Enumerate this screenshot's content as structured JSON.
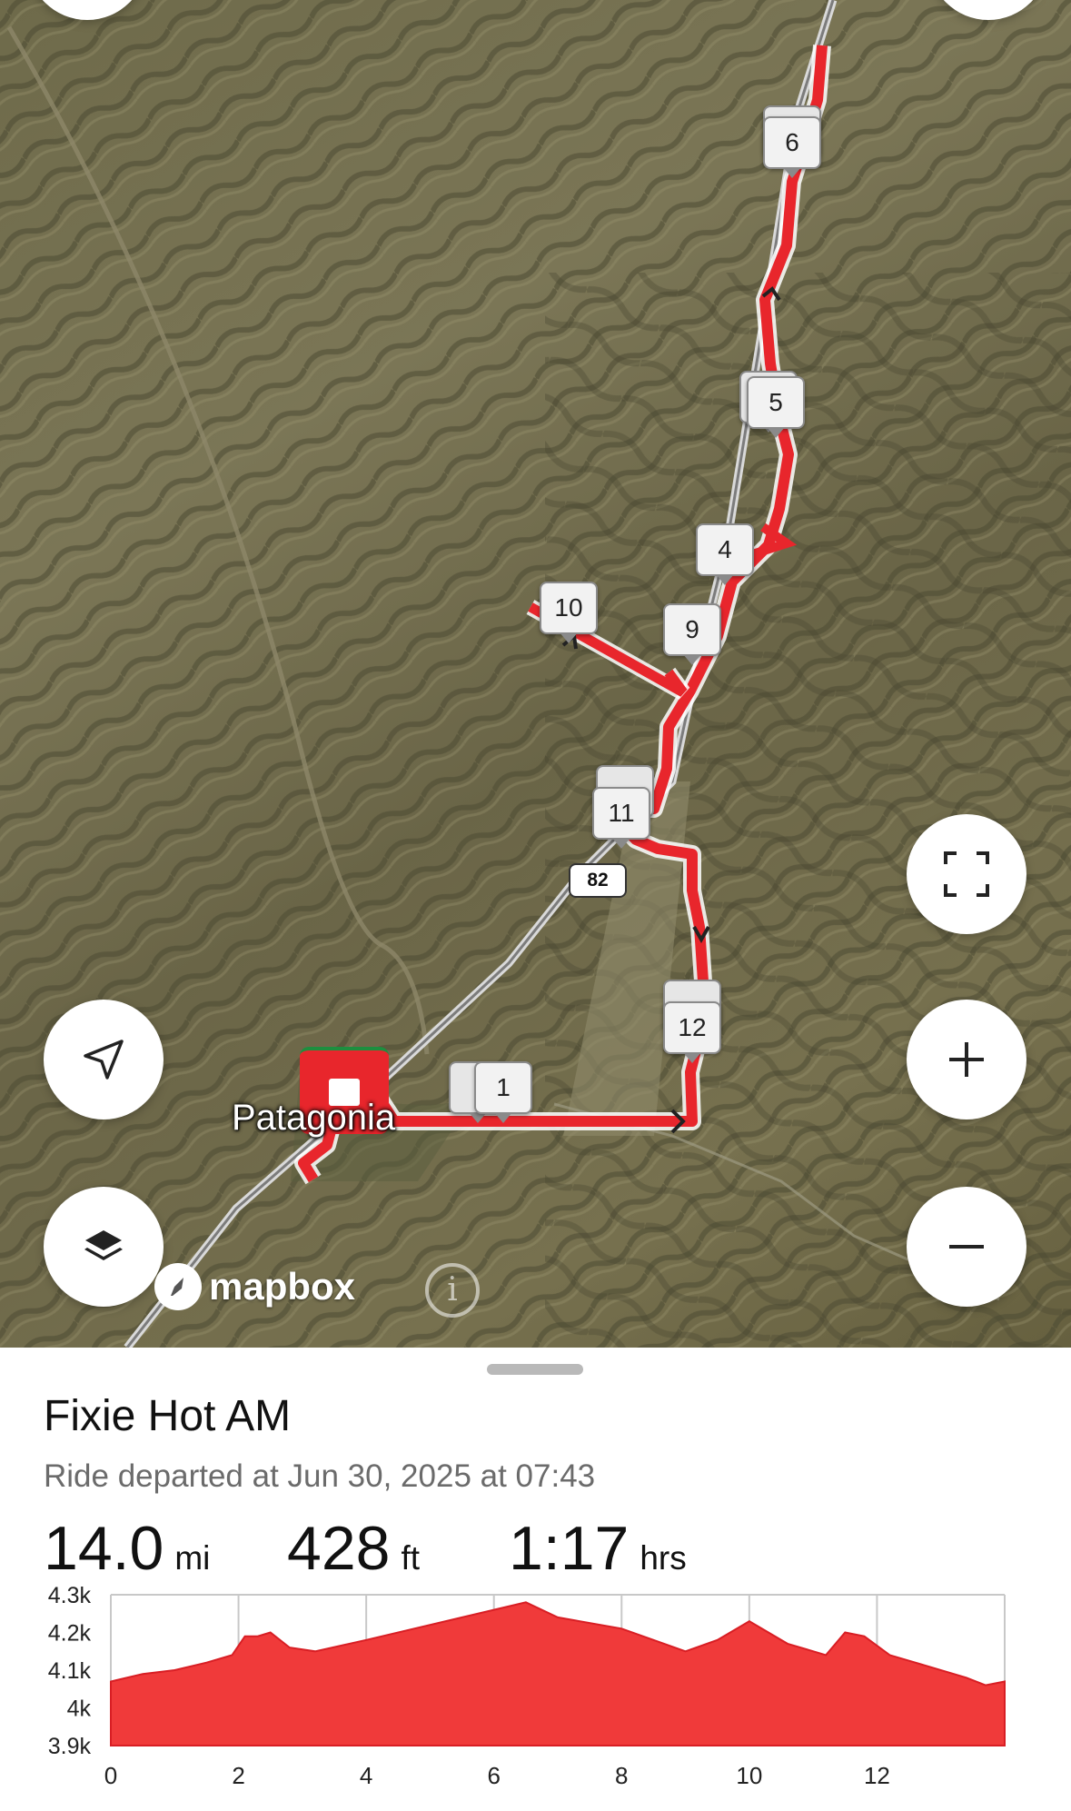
{
  "map": {
    "town_label": "Patagonia",
    "route_shield": "82",
    "attribution": "mapbox",
    "info_icon": "info-icon",
    "waypoints": [
      "6",
      "5",
      "4",
      "10",
      "9",
      "11",
      "12",
      "1"
    ],
    "buttons": {
      "locate": "navigation-arrow-icon",
      "layers": "layers-icon",
      "fullscreen": "fullscreen-icon",
      "zoom_in": "plus-icon",
      "zoom_out": "minus-icon"
    },
    "route_color": "#e8262c"
  },
  "ride": {
    "title": "Fixie Hot AM",
    "subtitle": "Ride departed at Jun 30, 2025 at 07:43",
    "distance": {
      "value": "14.0",
      "unit": "mi"
    },
    "elevation": {
      "value": "428",
      "unit": "ft"
    },
    "duration": {
      "value": "1:17",
      "unit": "hrs"
    }
  },
  "chart_data": {
    "type": "area",
    "title": "",
    "xlabel": "",
    "ylabel": "",
    "y_tick_labels": [
      "4.3k",
      "4.2k",
      "4.1k",
      "4k",
      "3.9k"
    ],
    "x_tick_labels": [
      "0",
      "2",
      "4",
      "6",
      "8",
      "10",
      "12"
    ],
    "xlim": [
      0,
      14
    ],
    "ylim": [
      3900,
      4300
    ],
    "grid": true,
    "color": "#f03a3a",
    "x": [
      0,
      0.5,
      1,
      1.5,
      1.9,
      2.1,
      2.3,
      2.5,
      2.8,
      3.2,
      4,
      5,
      6,
      6.5,
      7,
      8,
      9,
      9.5,
      10,
      10.6,
      11.2,
      11.5,
      11.8,
      12.2,
      12.8,
      13.4,
      13.7,
      14
    ],
    "values": [
      4070,
      4090,
      4100,
      4120,
      4140,
      4190,
      4190,
      4200,
      4160,
      4150,
      4180,
      4220,
      4260,
      4280,
      4240,
      4210,
      4150,
      4180,
      4230,
      4170,
      4140,
      4200,
      4190,
      4140,
      4110,
      4080,
      4060,
      4070
    ]
  }
}
